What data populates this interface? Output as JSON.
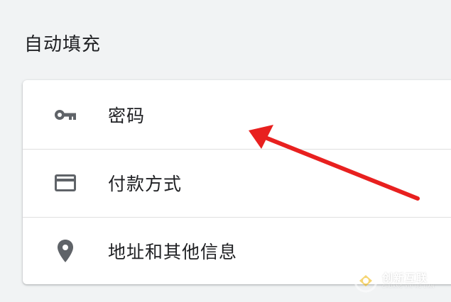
{
  "section": {
    "title": "自动填充"
  },
  "autofill": {
    "items": [
      {
        "label": "密码",
        "icon": "key-icon"
      },
      {
        "label": "付款方式",
        "icon": "credit-card-icon"
      },
      {
        "label": "地址和其他信息",
        "icon": "location-pin-icon"
      }
    ]
  },
  "colors": {
    "background": "#f1f3f4",
    "card": "#ffffff",
    "icon": "#5f6368",
    "annotation_arrow": "#e8201f"
  },
  "watermark": {
    "name": "创新互联",
    "sub": "CHUANG XIN HU LIAN"
  }
}
